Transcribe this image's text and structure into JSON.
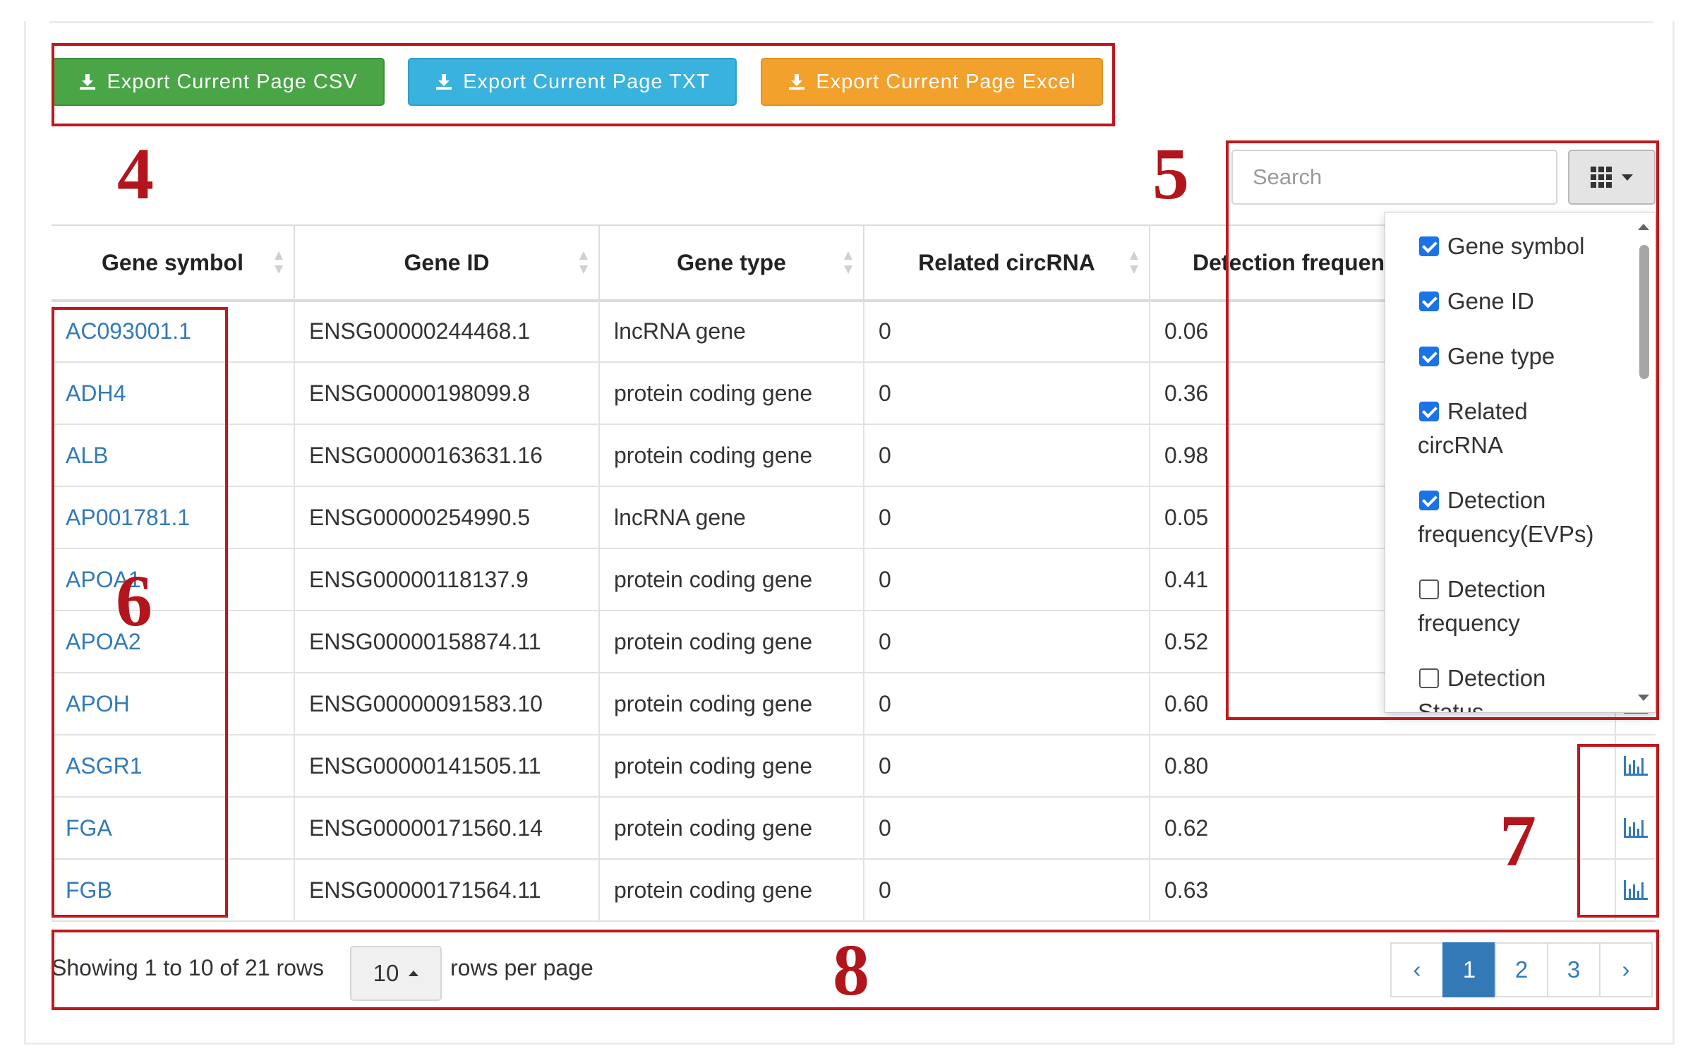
{
  "toolbar": {
    "export_csv": "Export Current Page CSV",
    "export_txt": "Export Current Page TXT",
    "export_excel": "Export Current Page Excel",
    "download_icon": "download-icon"
  },
  "search": {
    "placeholder": "Search"
  },
  "columns_button": {
    "icon": "grid-icon"
  },
  "table": {
    "headers": [
      "Gene symbol",
      "Gene ID",
      "Gene type",
      "Related circRNA",
      "Detection frequen"
    ],
    "rows": [
      {
        "symbol": "AC093001.1",
        "id": "ENSG00000244468.1",
        "type": "lncRNA gene",
        "circ": "0",
        "freq": "0.06"
      },
      {
        "symbol": "ADH4",
        "id": "ENSG00000198099.8",
        "type": "protein coding gene",
        "circ": "0",
        "freq": "0.36"
      },
      {
        "symbol": "ALB",
        "id": "ENSG00000163631.16",
        "type": "protein coding gene",
        "circ": "0",
        "freq": "0.98"
      },
      {
        "symbol": "AP001781.1",
        "id": "ENSG00000254990.5",
        "type": "lncRNA gene",
        "circ": "0",
        "freq": "0.05"
      },
      {
        "symbol": "APOA1",
        "id": "ENSG00000118137.9",
        "type": "protein coding gene",
        "circ": "0",
        "freq": "0.41"
      },
      {
        "symbol": "APOA2",
        "id": "ENSG00000158874.11",
        "type": "protein coding gene",
        "circ": "0",
        "freq": "0.52"
      },
      {
        "symbol": "APOH",
        "id": "ENSG00000091583.10",
        "type": "protein coding gene",
        "circ": "0",
        "freq": "0.60"
      },
      {
        "symbol": "ASGR1",
        "id": "ENSG00000141505.11",
        "type": "protein coding gene",
        "circ": "0",
        "freq": "0.80"
      },
      {
        "symbol": "FGA",
        "id": "ENSG00000171560.14",
        "type": "protein coding gene",
        "circ": "0",
        "freq": "0.62"
      },
      {
        "symbol": "FGB",
        "id": "ENSG00000171564.11",
        "type": "protein coding gene",
        "circ": "0",
        "freq": "0.63"
      }
    ],
    "chart_icon": "bar-chart-icon"
  },
  "column_menu": {
    "items": [
      {
        "label": "Gene symbol",
        "cont": "",
        "checked": true
      },
      {
        "label": "Gene ID",
        "cont": "",
        "checked": true
      },
      {
        "label": "Gene type",
        "cont": "",
        "checked": true
      },
      {
        "label": "Related",
        "cont": "circRNA",
        "checked": true
      },
      {
        "label": "Detection",
        "cont": "frequency(EVPs)",
        "checked": true
      },
      {
        "label": "Detection",
        "cont": "frequency",
        "checked": false
      },
      {
        "label": "Detection",
        "cont": "Status",
        "checked": false
      }
    ]
  },
  "pagination": {
    "showing": "Showing 1 to 10 of 21 rows",
    "page_size": "10",
    "rows_per_page": "rows per page",
    "prev": "‹",
    "pages": [
      "1",
      "2",
      "3"
    ],
    "next": "›",
    "active_page": "1"
  },
  "annotations": {
    "labels": [
      "4",
      "5",
      "6",
      "7",
      "8"
    ],
    "color": "#c0181c"
  },
  "colors": {
    "csv_button": "#4aa547",
    "txt_button": "#3ab2de",
    "excel_button": "#f2a12d",
    "link": "#337ab7",
    "checkbox": "#1a73e8"
  }
}
